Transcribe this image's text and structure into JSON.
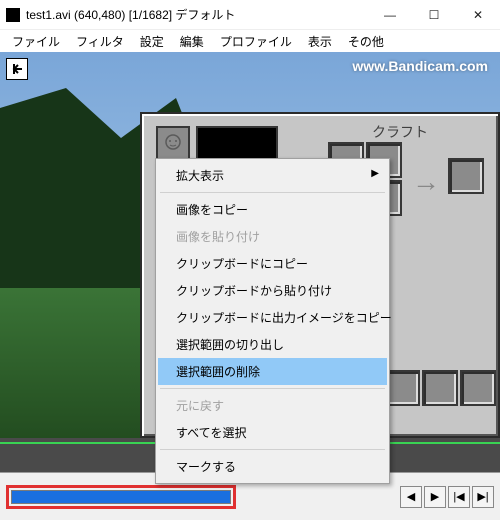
{
  "titlebar": {
    "text": "test1.avi (640,480) [1/1682] デフォルト"
  },
  "menubar": [
    "ファイル",
    "フィルタ",
    "設定",
    "編集",
    "プロファイル",
    "表示",
    "その他"
  ],
  "watermark": "www.Bandicam.com",
  "inventory": {
    "craft_label": "クラフト"
  },
  "context_menu": [
    {
      "label": "拡大表示",
      "sub": true
    },
    {
      "sep": true
    },
    {
      "label": "画像をコピー"
    },
    {
      "label": "画像を貼り付け",
      "disabled": true
    },
    {
      "label": "クリップボードにコピー"
    },
    {
      "label": "クリップボードから貼り付け"
    },
    {
      "label": "クリップボードに出力イメージをコピー"
    },
    {
      "label": "選択範囲の切り出し"
    },
    {
      "label": "選択範囲の削除",
      "hover": true
    },
    {
      "sep": true
    },
    {
      "label": "元に戻す",
      "disabled": true
    },
    {
      "label": "すべてを選択"
    },
    {
      "sep": true
    },
    {
      "label": "マークする"
    }
  ],
  "nav_icons": [
    "◀",
    "▶",
    "|◀",
    "▶|"
  ]
}
